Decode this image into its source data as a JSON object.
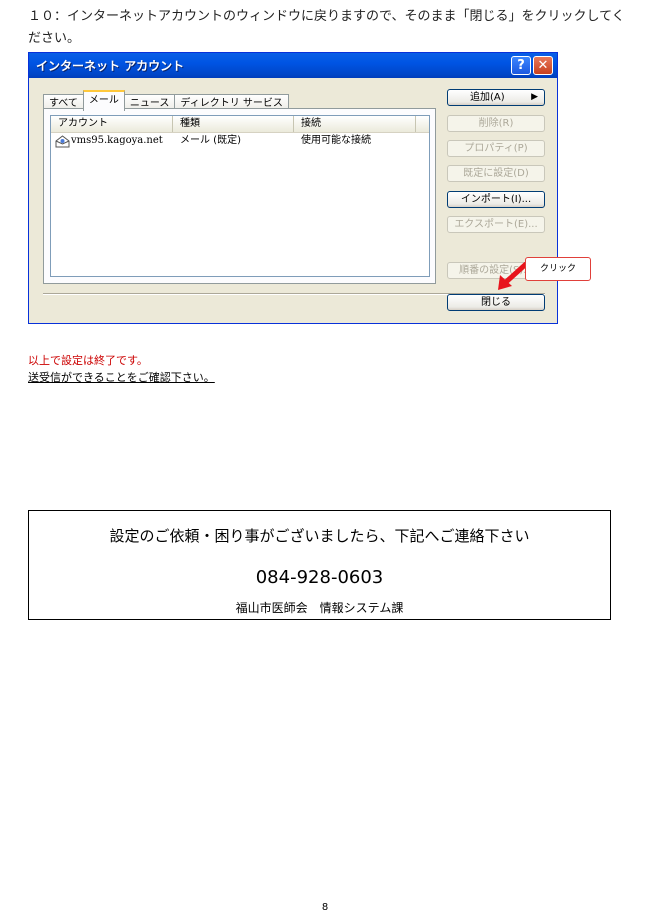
{
  "instruction": "１０：インターネットアカウントのウィンドウに戻りますので、そのまま「閉じる」をクリックしてください。",
  "dialog": {
    "title": "インターネット アカウント",
    "help_label": "?",
    "close_label": "✕",
    "tabs": [
      {
        "label": "すべて"
      },
      {
        "label": "メール"
      },
      {
        "label": "ニュース"
      },
      {
        "label": "ディレクトリ サービス"
      }
    ],
    "columns": [
      "アカウント",
      "種類",
      "接続"
    ],
    "rows": [
      {
        "account": "vms95.kagoya.net",
        "type": "メール (既定)",
        "connection": "使用可能な接続"
      }
    ],
    "buttons": {
      "add": "追加(A)",
      "add_arrow": "▶",
      "remove": "削除(R)",
      "properties": "プロパティ(P)",
      "set_default": "既定に設定(D)",
      "import": "インポート(I)...",
      "export": "エクスポート(E)...",
      "order": "順番の設定(S)...",
      "close": "閉じる"
    }
  },
  "callout": "クリック",
  "end": {
    "line1": "以上で設定は終了です。",
    "line2": "送受信ができることをご確認下さい。"
  },
  "contact": {
    "line1": "設定のご依頼・困り事がございましたら、下記へご連絡下さい",
    "phone": "084-928-0603",
    "org": "福山市医師会　情報システム課"
  },
  "page_number": "8"
}
